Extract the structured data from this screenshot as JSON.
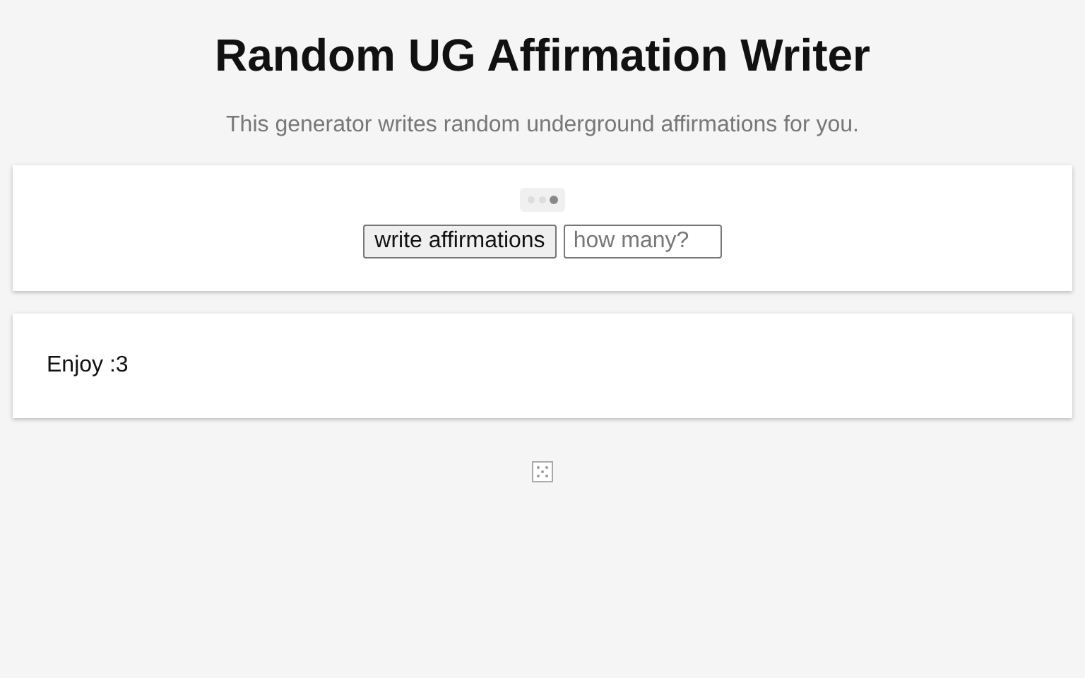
{
  "title": "Random UG Affirmation Writer",
  "subtitle": "This generator writes random underground affirmations for you.",
  "controls": {
    "button": "write affirmations",
    "count_field": {
      "placeholder": "how many?"
    }
  },
  "output": {
    "text": "Enjoy :3"
  }
}
